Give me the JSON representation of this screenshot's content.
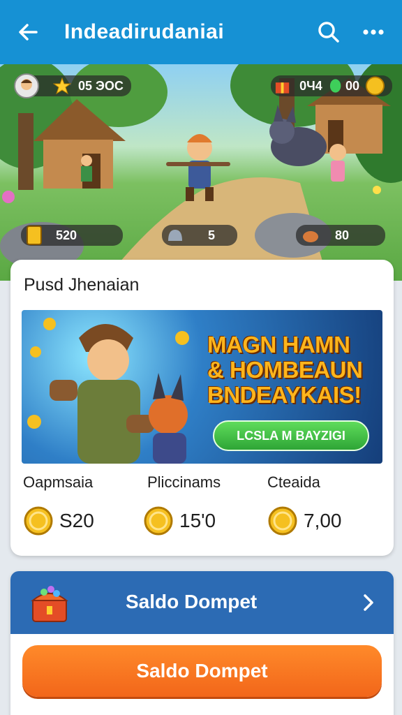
{
  "appbar": {
    "title": "Indeadirudaniai",
    "icons": [
      "back-arrow-icon",
      "search-icon",
      "more-icon"
    ]
  },
  "scene": {
    "hud_top_left": "05 ЭОС",
    "hud_top_right_a": "0Ч4",
    "hud_top_right_b": "00",
    "hud_bottom_left": "520",
    "hud_bottom_center": "5",
    "hud_bottom_right": "80"
  },
  "promo": {
    "title": "Pusd Jhenaian",
    "banner_headline": [
      "MAGN HAMN",
      "& HOMBEAUN",
      "BNDEAYKAIS!"
    ],
    "banner_button": "LCSLA M BAYZIGI",
    "stats": [
      {
        "label": "Oapmsaia",
        "value": "S20"
      },
      {
        "label": "Pliccinams",
        "value": "15'0"
      },
      {
        "label": "Cteaida",
        "value": "7,00"
      }
    ]
  },
  "wallet": {
    "header_title": "Saldo Dompet",
    "button_label": "Saldo Dompet"
  },
  "colors": {
    "appbar": "#1691d4",
    "wallet_header": "#2c6bb4",
    "wallet_button": "#f2661a",
    "banner_button": "#2ea536",
    "coin": "#f5c020"
  }
}
